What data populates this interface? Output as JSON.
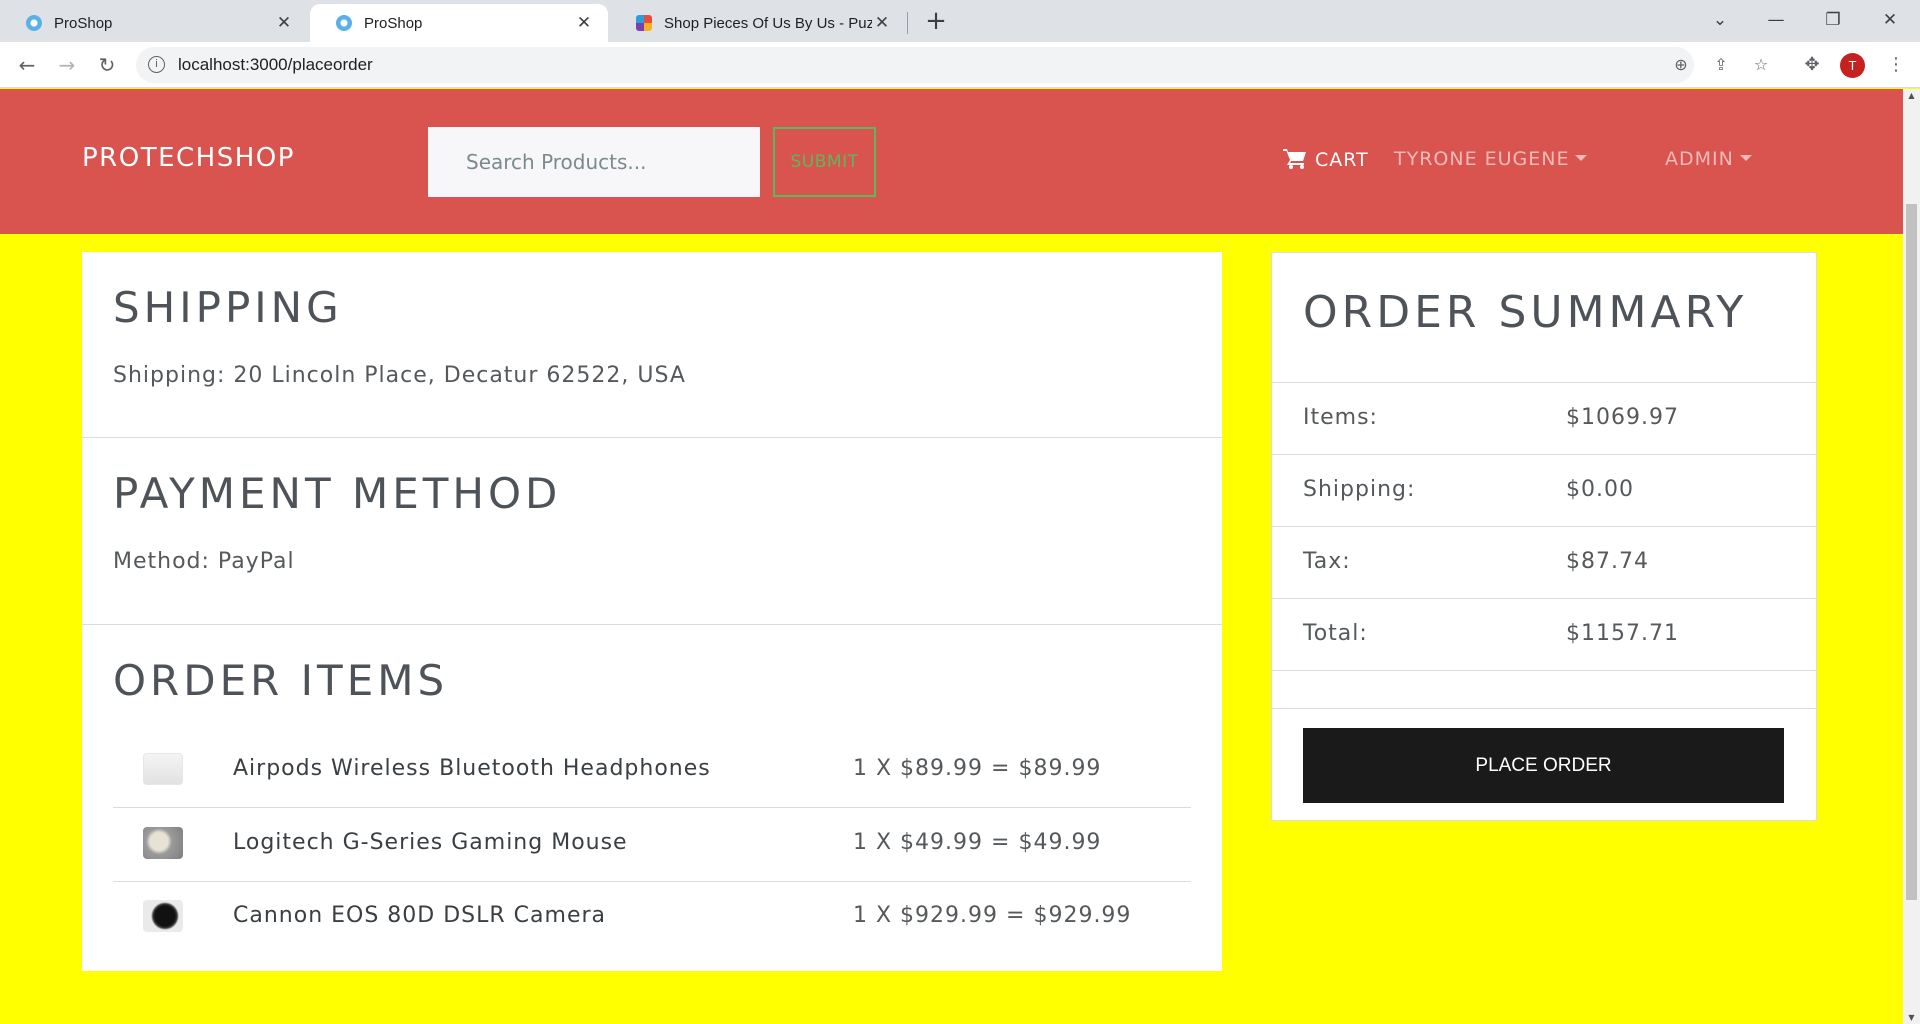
{
  "browser": {
    "tabs": [
      {
        "title": "ProShop",
        "favicon": "proshop-favicon"
      },
      {
        "title": "ProShop",
        "favicon": "proshop-favicon"
      },
      {
        "title": "Shop Pieces Of Us By Us - Puzzle",
        "favicon": "puzzle-favicon"
      }
    ],
    "url": "localhost:3000/placeorder",
    "profile_initial": "T"
  },
  "navbar": {
    "brand": "PROTECHSHOP",
    "search_placeholder": "Search Products...",
    "submit_label": "SUBMIT",
    "cart_label": "CART",
    "user_label": "TYRONE EUGENE",
    "admin_label": "ADMIN",
    "bg_color": "#d9534f"
  },
  "shipping": {
    "title": "SHIPPING",
    "text": "Shipping: 20 Lincoln Place, Decatur 62522, USA"
  },
  "payment": {
    "title": "PAYMENT METHOD",
    "text": "Method: PayPal"
  },
  "order_items": {
    "title": "ORDER ITEMS",
    "items": [
      {
        "name": "Airpods Wireless Bluetooth Headphones",
        "price": "1 X $89.99 = $89.99",
        "image": "airpods-thumbnail"
      },
      {
        "name": "Logitech G-Series Gaming Mouse",
        "price": "1 X $49.99 = $49.99",
        "image": "mouse-thumbnail"
      },
      {
        "name": "Cannon EOS 80D DSLR Camera",
        "price": "1 X $929.99 = $929.99",
        "image": "camera-thumbnail"
      }
    ]
  },
  "summary": {
    "title": "ORDER SUMMARY",
    "rows": [
      {
        "label": "Items:",
        "value": "$1069.97"
      },
      {
        "label": "Shipping:",
        "value": "$0.00"
      },
      {
        "label": "Tax:",
        "value": "$87.74"
      },
      {
        "label": "Total:",
        "value": "$1157.71"
      }
    ],
    "place_order_label": "PLACE ORDER"
  },
  "page_bg_color": "#ffff00"
}
